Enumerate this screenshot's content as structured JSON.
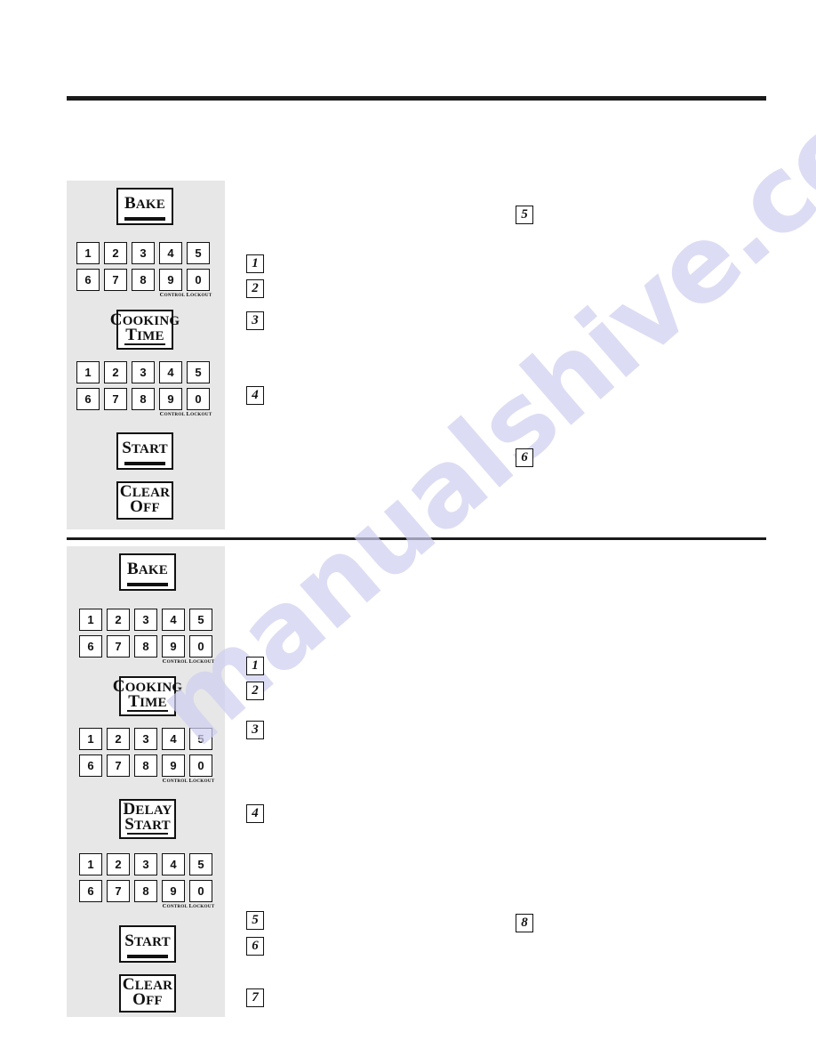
{
  "document": {
    "watermark_text": "manualshive.com",
    "watermark_color": "#cfcff0",
    "page_background": "#ffffff",
    "panel_background": "#e7e7e7",
    "ink_color": "#1a1a1a"
  },
  "rules": {
    "top_rule": "",
    "middle_rule": ""
  },
  "keypad_digits": {
    "row1": [
      "1",
      "2",
      "3",
      "4",
      "5"
    ],
    "row2": [
      "6",
      "7",
      "8",
      "9",
      "0"
    ],
    "lockout_label": "Control Lockout",
    "lockout_cap_c": "C",
    "lockout_rest_control": "ONTROL",
    "lockout_cap_l": "L",
    "lockout_rest_lockout": "OCKOUT"
  },
  "section_one": {
    "name": "cooking-time-procedure",
    "panel": {
      "buttons": [
        {
          "name": "bake-button",
          "lines": [
            {
              "cap": "B",
              "rest": "AKE"
            }
          ]
        },
        {
          "name": "cooking-time-button",
          "lines": [
            {
              "cap": "C",
              "rest": "OOKING"
            },
            {
              "cap": "T",
              "rest": "IME"
            }
          ]
        },
        {
          "name": "start-button",
          "lines": [
            {
              "cap": "S",
              "rest": "TART"
            }
          ]
        },
        {
          "name": "clear-off-button",
          "lines": [
            {
              "cap": "C",
              "rest": "LEAR"
            },
            {
              "cap": "O",
              "rest": "FF"
            }
          ]
        }
      ]
    },
    "steps_left": [
      "1",
      "2",
      "3",
      "4"
    ],
    "steps_right": [
      "5",
      "6"
    ]
  },
  "section_two": {
    "name": "delay-start-procedure",
    "panel": {
      "buttons": [
        {
          "name": "bake-button",
          "lines": [
            {
              "cap": "B",
              "rest": "AKE"
            }
          ]
        },
        {
          "name": "cooking-time-button",
          "lines": [
            {
              "cap": "C",
              "rest": "OOKING"
            },
            {
              "cap": "T",
              "rest": "IME"
            }
          ]
        },
        {
          "name": "delay-start-button",
          "lines": [
            {
              "cap": "D",
              "rest": "ELAY"
            },
            {
              "cap": "S",
              "rest": "TART"
            }
          ]
        },
        {
          "name": "start-button",
          "lines": [
            {
              "cap": "S",
              "rest": "TART"
            }
          ]
        },
        {
          "name": "clear-off-button",
          "lines": [
            {
              "cap": "C",
              "rest": "LEAR"
            },
            {
              "cap": "O",
              "rest": "FF"
            }
          ]
        }
      ]
    },
    "steps_left": [
      "1",
      "2",
      "3",
      "4",
      "5",
      "6",
      "7"
    ],
    "steps_right": [
      "8"
    ]
  }
}
